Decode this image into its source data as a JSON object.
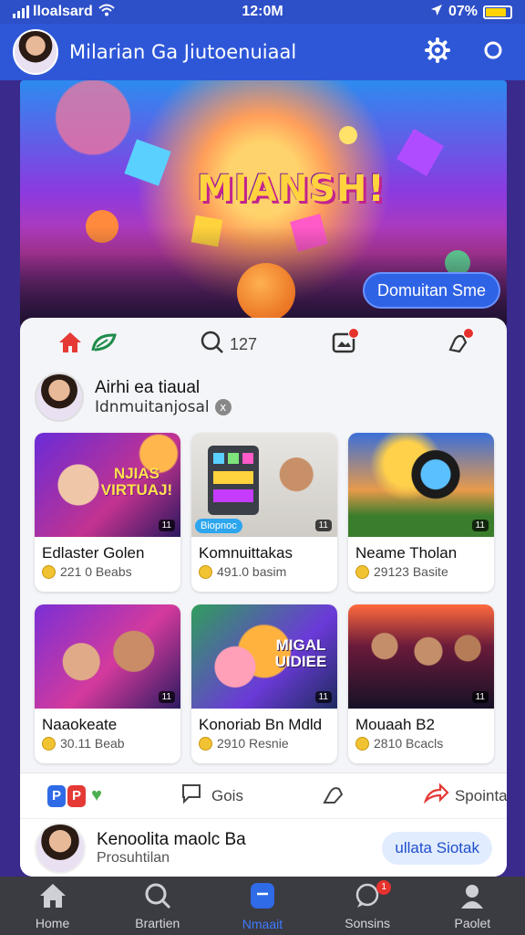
{
  "status": {
    "carrier": "lloalsard",
    "time": "12:0M",
    "battery": "07%"
  },
  "header": {
    "title": "Milarian Ga Jiutoenuiaal"
  },
  "hero": {
    "brand": "MIANSH!",
    "cta_label": "Domuitan Sme"
  },
  "tabs": [
    {
      "icon": "home-icon",
      "label": ""
    },
    {
      "icon": "leaf-icon",
      "label": ""
    },
    {
      "icon": "search-icon",
      "label": "127"
    },
    {
      "icon": "image-icon",
      "label": ""
    },
    {
      "icon": "notification-icon",
      "label": ""
    }
  ],
  "profile": {
    "name": "Airhi ea tiaual",
    "subtitle": "Idnmuitanjosal",
    "close_glyph": "x"
  },
  "tiles": [
    {
      "title": "Edlaster Golen",
      "meta": "221 0 Beabs",
      "overlay": "NJIAS VIRTUAJ!",
      "duration": "11",
      "tag": "",
      "thumb": "purple"
    },
    {
      "title": "Komnuittakas",
      "meta": "491.0 basim",
      "overlay": "",
      "duration": "11",
      "tag": "Biopnoc",
      "thumb": "room"
    },
    {
      "title": "Neame Tholan",
      "meta": "29123 Basite",
      "overlay": "",
      "duration": "11",
      "tag": "",
      "thumb": "field"
    },
    {
      "title": "Naaokeate",
      "meta": "30.11 Beab",
      "overlay": "",
      "duration": "11",
      "tag": "",
      "thumb": "pink"
    },
    {
      "title": "Konoriab Bn Mdld",
      "meta": "2910 Resnie",
      "overlay": "MIGAL UIDIEE",
      "duration": "11",
      "tag": "",
      "thumb": "green"
    },
    {
      "title": "Mouaah B2",
      "meta": "2810 Bcacls",
      "overlay": "",
      "duration": "11",
      "tag": "",
      "thumb": "party"
    }
  ],
  "actionbar": {
    "app_letters": [
      "P",
      "P"
    ],
    "gois": "Gois",
    "spointand": "Spointand"
  },
  "contact": {
    "name": "Kenoolita maolc",
    "suffix": "Ba",
    "subtitle": "Prosuhtilan",
    "pill": "ullata Siotak"
  },
  "nav": [
    {
      "label": "Home",
      "icon": "home-icon",
      "active": false
    },
    {
      "label": "Brartien",
      "icon": "search-icon",
      "active": false
    },
    {
      "label": "Nmaait",
      "icon": "message-icon",
      "active": true
    },
    {
      "label": "Sonsins",
      "icon": "chat-icon",
      "active": false,
      "badge": "1"
    },
    {
      "label": "Paolet",
      "icon": "profile-icon",
      "active": false
    }
  ],
  "colors": {
    "header_bg": "#2e57d8",
    "accent": "#3c7bff",
    "badge": "#e5322d",
    "nav_bg": "#3b3b42"
  }
}
